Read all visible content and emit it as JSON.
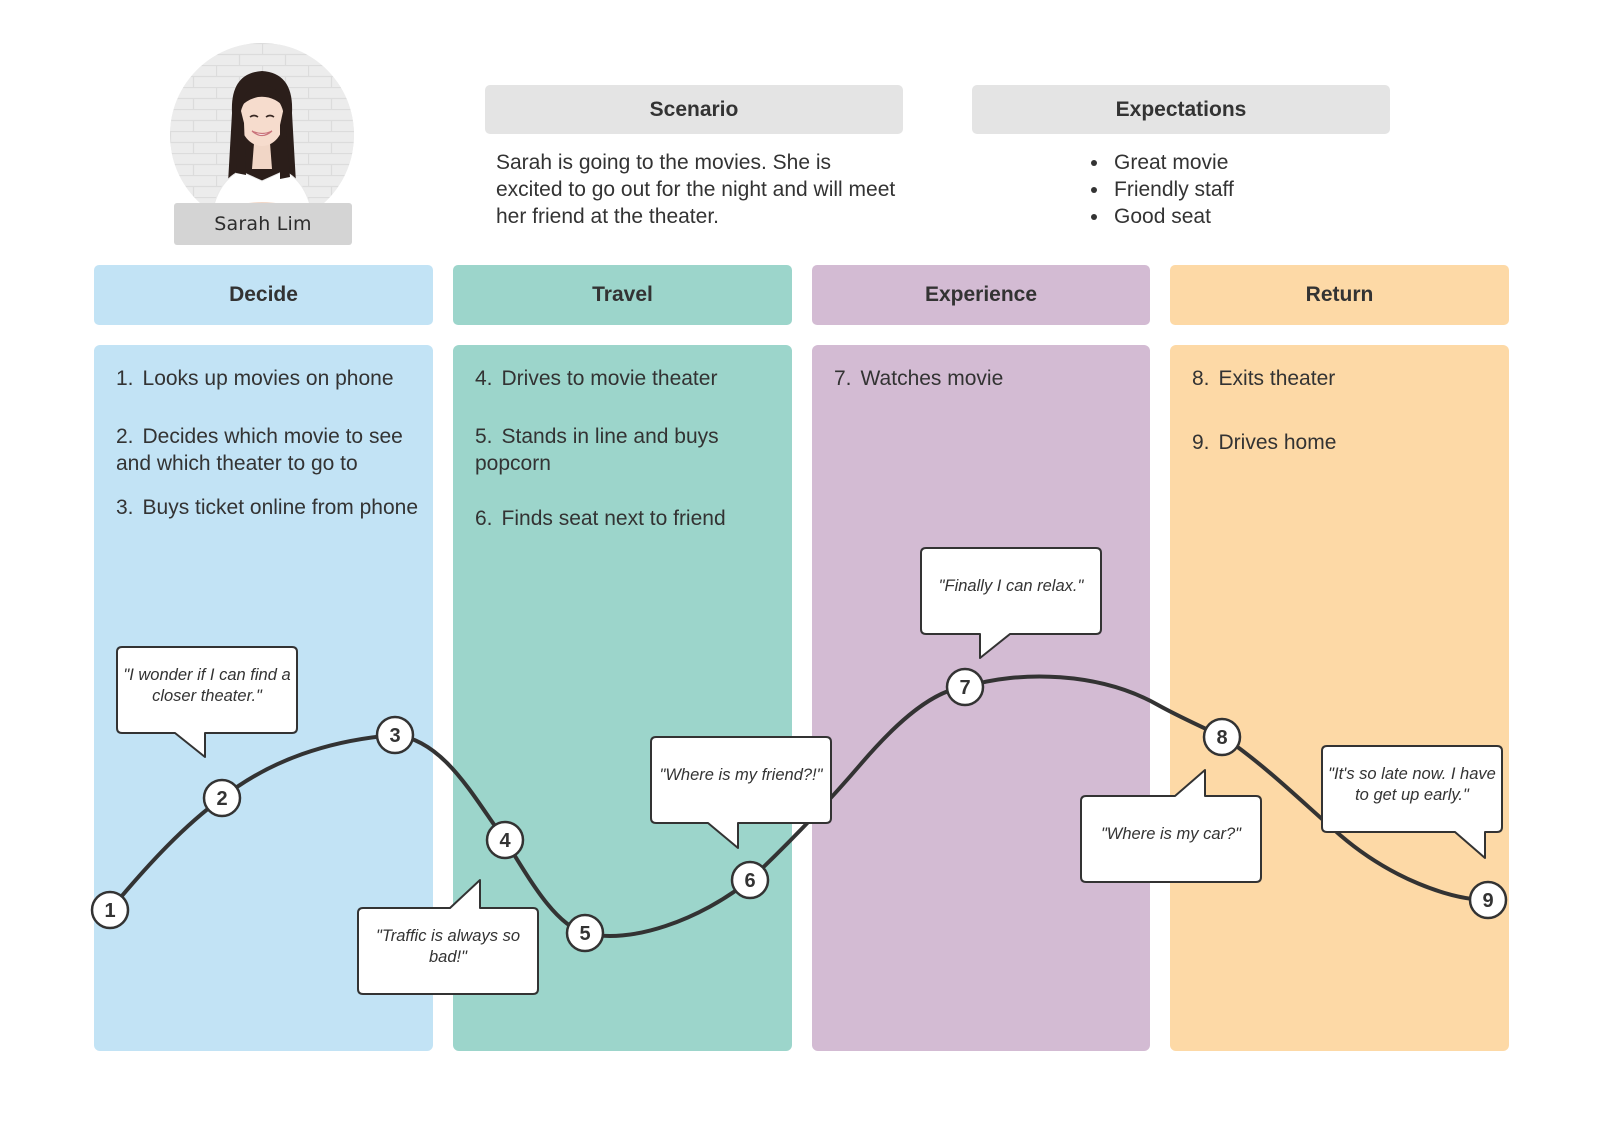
{
  "persona": {
    "name": "Sarah Lim",
    "photo": "persona-photo"
  },
  "scenario": {
    "heading": "Scenario",
    "text": "Sarah is going to the movies. She is excited to go out for the night and will meet her friend at the theater."
  },
  "expectations": {
    "heading": "Expectations",
    "items": [
      "Great movie",
      "Friendly staff",
      "Good seat"
    ]
  },
  "colors": {
    "decide": "#c2e3f5",
    "travel": "#9cd5cb",
    "experience": "#d3bbd3",
    "return": "#fdd9a6",
    "curve": "#333333",
    "header_grey": "#e4e4e4"
  },
  "stages": [
    {
      "name": "Decide",
      "steps": [
        {
          "num": "1.",
          "text": "Looks up movies on phone"
        },
        {
          "num": "2.",
          "text": "Decides which movie to see and which theater to go to"
        },
        {
          "num": "3.",
          "text": "Buys ticket online from phone"
        }
      ]
    },
    {
      "name": "Travel",
      "steps": [
        {
          "num": "4.",
          "text": "Drives to movie theater"
        },
        {
          "num": "5.",
          "text": "Stands in line and buys popcorn"
        },
        {
          "num": "6.",
          "text": "Finds seat next to friend"
        }
      ]
    },
    {
      "name": "Experience",
      "steps": [
        {
          "num": "7.",
          "text": "Watches movie"
        }
      ]
    },
    {
      "name": "Return",
      "steps": [
        {
          "num": "8.",
          "text": "Exits theater"
        },
        {
          "num": "9.",
          "text": "Drives home"
        }
      ]
    }
  ],
  "journey_points": [
    {
      "label": "1",
      "stage": "Decide",
      "emotion": "low"
    },
    {
      "label": "2",
      "stage": "Decide",
      "emotion": "medium"
    },
    {
      "label": "3",
      "stage": "Decide",
      "emotion": "high"
    },
    {
      "label": "4",
      "stage": "Travel",
      "emotion": "medium-low"
    },
    {
      "label": "5",
      "stage": "Travel",
      "emotion": "lowest"
    },
    {
      "label": "6",
      "stage": "Travel",
      "emotion": "low"
    },
    {
      "label": "7",
      "stage": "Experience",
      "emotion": "highest"
    },
    {
      "label": "8",
      "stage": "Return",
      "emotion": "high"
    },
    {
      "label": "9",
      "stage": "Return",
      "emotion": "low"
    }
  ],
  "quotes": [
    {
      "point": "2",
      "text": "\"I wonder if I can find a closer theater.\""
    },
    {
      "point": "4",
      "text": "\"Traffic is always so bad!\""
    },
    {
      "point": "6",
      "text": "\"Where is my friend?!\""
    },
    {
      "point": "7",
      "text": "\"Finally I can relax.\""
    },
    {
      "point": "8",
      "text": "\"Where is my car?\""
    },
    {
      "point": "9",
      "text": "\"It's so late now. I have to get up early.\""
    }
  ]
}
